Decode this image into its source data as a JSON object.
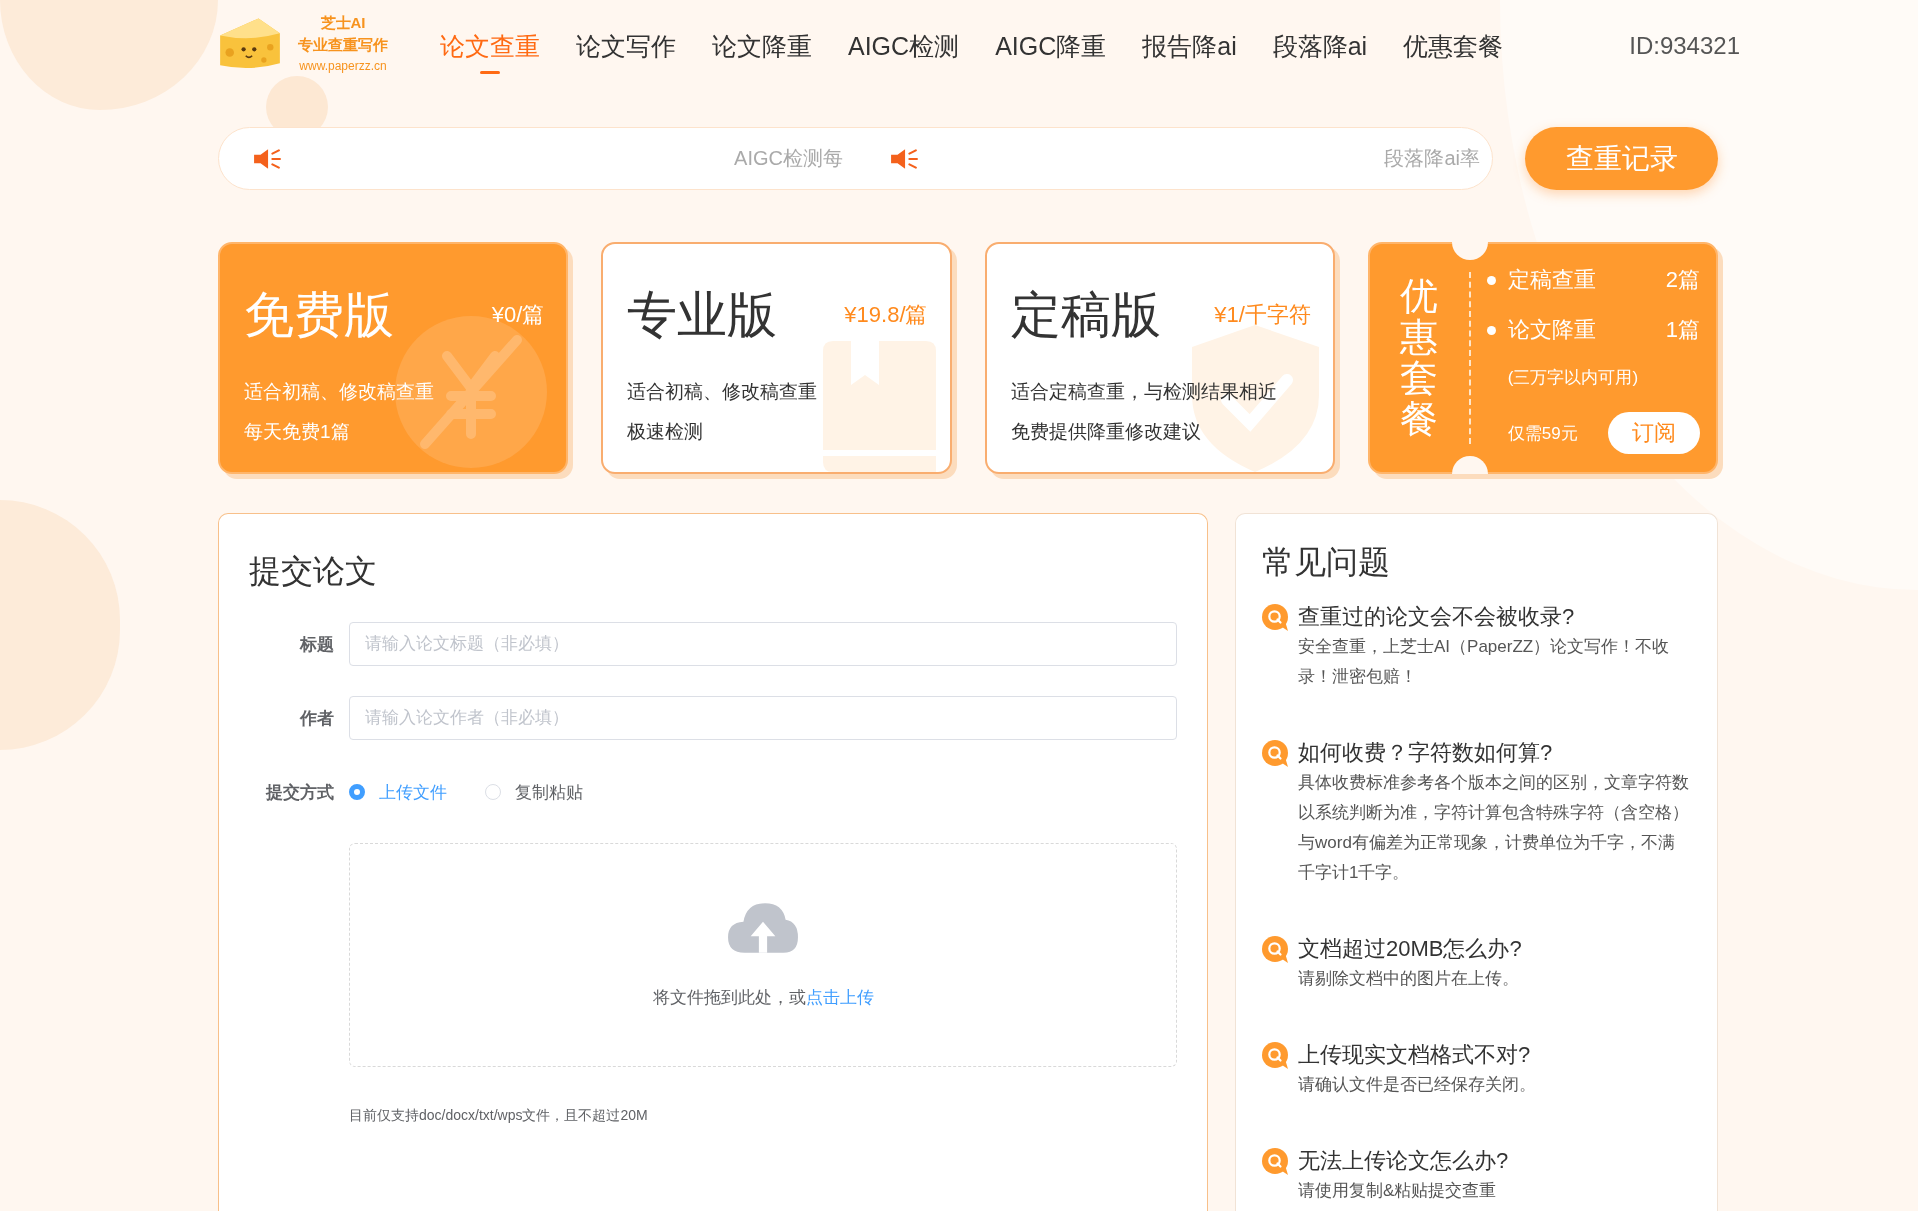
{
  "header": {
    "logo": {
      "name": "芝士AI",
      "tagline": "专业查重写作",
      "url": "www.paperzz.cn"
    },
    "nav": [
      {
        "label": "论文查重",
        "selected": true
      },
      {
        "label": "论文写作",
        "selected": false
      },
      {
        "label": "论文降重",
        "selected": false
      },
      {
        "label": "AIGC检测",
        "selected": false
      },
      {
        "label": "AIGC降重",
        "selected": false
      },
      {
        "label": "报告降ai",
        "selected": false
      },
      {
        "label": "段落降ai",
        "selected": false
      },
      {
        "label": "优惠套餐",
        "selected": false
      }
    ],
    "user_id": "ID:934321"
  },
  "notices": [
    "AIGC检测每",
    "段落降ai率"
  ],
  "history_button": "查重记录",
  "plans": [
    {
      "kind": "free",
      "title": "免费版",
      "price": "¥0/篇",
      "features": [
        "适合初稿、修改稿查重",
        "每天免费1篇"
      ]
    },
    {
      "kind": "pro",
      "title": "专业版",
      "price": "¥19.8/篇",
      "features": [
        "适合初稿、修改稿查重",
        "极速检测"
      ]
    },
    {
      "kind": "final",
      "title": "定稿版",
      "price": "¥1/千字符",
      "features": [
        "适合定稿查重，与检测结果相近",
        "免费提供降重修改建议"
      ]
    }
  ],
  "bundle": {
    "title": "优惠套餐",
    "items": [
      {
        "name": "定稿查重",
        "count": "2篇"
      },
      {
        "name": "论文降重",
        "count": "1篇"
      }
    ],
    "note": "(三万字以内可用)",
    "price": "仅需59元",
    "button": "订阅"
  },
  "submit": {
    "title": "提交论文",
    "fields": [
      {
        "label": "标题",
        "placeholder": "请输入论文标题（非必填）"
      },
      {
        "label": "作者",
        "placeholder": "请输入论文作者（非必填）"
      }
    ],
    "method": {
      "label": "提交方式",
      "options": [
        {
          "label": "上传文件",
          "selected": true
        },
        {
          "label": "复制粘贴",
          "selected": false
        }
      ]
    },
    "upload": {
      "text": "将文件拖到此处，或",
      "link": "点击上传"
    },
    "hint": "目前仅支持doc/docx/txt/wps文件，且不超过20M"
  },
  "faq": {
    "title": "常见问题",
    "items": [
      {
        "question": "查重过的论文会不会被收录?",
        "answer": "安全查重，上芝士AI（PaperZZ）论文写作！不收录！泄密包赔！"
      },
      {
        "question": "如何收费？字符数如何算?",
        "answer": "具体收费标准参考各个版本之间的区别，文章字符数以系统判断为准，字符计算包含特殊字符（含空格）与word有偏差为正常现象，计费单位为千字，不满千字计1千字。"
      },
      {
        "question": "文档超过20MB怎么办?",
        "answer": "请剔除文档中的图片在上传。"
      },
      {
        "question": "上传现实文档格式不对?",
        "answer": "请确认文件是否已经保存关闭。"
      },
      {
        "question": "无法上传论文怎么办?",
        "answer": "请使用复制&粘贴提交查重"
      }
    ]
  }
}
